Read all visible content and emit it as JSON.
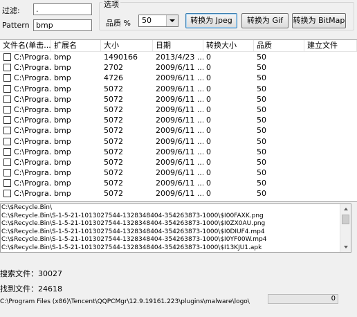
{
  "filter": {
    "label": "过滤:",
    "value": ".",
    "pattern_label": "Pattern",
    "pattern_value": "bmp"
  },
  "options": {
    "title": "选项",
    "quality_label": "品质 %",
    "quality_value": "50",
    "buttons": {
      "to_jpeg": "转换为 Jpeg",
      "to_gif": "转换为 Gif",
      "to_bitmap": "转换为 BitMap"
    }
  },
  "table": {
    "columns": [
      "文件名(单击...",
      "扩展名",
      "大小",
      "日期",
      "转换大小",
      "品质",
      "建立文件"
    ],
    "rows": [
      [
        "C:\\Progra...",
        "bmp",
        "1490166",
        "2013/4/23 ...",
        "0",
        "50",
        ""
      ],
      [
        "C:\\Progra...",
        "bmp",
        "2702",
        "2009/6/11 ...",
        "0",
        "50",
        ""
      ],
      [
        "C:\\Progra...",
        "bmp",
        "4726",
        "2009/6/11 ...",
        "0",
        "50",
        ""
      ],
      [
        "C:\\Progra...",
        "bmp",
        "5072",
        "2009/6/11 ...",
        "0",
        "50",
        ""
      ],
      [
        "C:\\Progra...",
        "bmp",
        "5072",
        "2009/6/11 ...",
        "0",
        "50",
        ""
      ],
      [
        "C:\\Progra...",
        "bmp",
        "5072",
        "2009/6/11 ...",
        "0",
        "50",
        ""
      ],
      [
        "C:\\Progra...",
        "bmp",
        "5072",
        "2009/6/11 ...",
        "0",
        "50",
        ""
      ],
      [
        "C:\\Progra...",
        "bmp",
        "5072",
        "2009/6/11 ...",
        "0",
        "50",
        ""
      ],
      [
        "C:\\Progra...",
        "bmp",
        "5072",
        "2009/6/11 ...",
        "0",
        "50",
        ""
      ],
      [
        "C:\\Progra...",
        "bmp",
        "5072",
        "2009/6/11 ...",
        "0",
        "50",
        ""
      ],
      [
        "C:\\Progra...",
        "bmp",
        "5072",
        "2009/6/11 ...",
        "0",
        "50",
        ""
      ],
      [
        "C:\\Progra...",
        "bmp",
        "5072",
        "2009/6/11 ...",
        "0",
        "50",
        ""
      ],
      [
        "C:\\Progra...",
        "bmp",
        "5072",
        "2009/6/11 ...",
        "0",
        "50",
        ""
      ],
      [
        "C:\\Progra...",
        "bmp",
        "5072",
        "2009/6/11 ...",
        "0",
        "50",
        ""
      ]
    ]
  },
  "log": [
    "C:\\$Recycle.Bin\\",
    "C:\\$Recycle.Bin\\S-1-5-21-1013027544-1328348404-354263873-1000\\$I00FAXK.png",
    "C:\\$Recycle.Bin\\S-1-5-21-1013027544-1328348404-354263873-1000\\$I0ZX0AU.png",
    "C:\\$Recycle.Bin\\S-1-5-21-1013027544-1328348404-354263873-1000\\$I0DIUF4.mp4",
    "C:\\$Recycle.Bin\\S-1-5-21-1013027544-1328348404-354263873-1000\\$I0YF00W.mp4",
    "C:\\$Recycle.Bin\\S-1-5-21-1013027544-1328348404-354263873-1000\\$I13KJU1.apk"
  ],
  "status": {
    "searched": "搜索文件：30027",
    "found": "找到文件：24618",
    "current_path": "C:\\Program Files (x86)\\Tencent\\QQPCMgr\\12.9.19161.223\\plugins\\malware\\logo\\",
    "progress_value": "0"
  }
}
